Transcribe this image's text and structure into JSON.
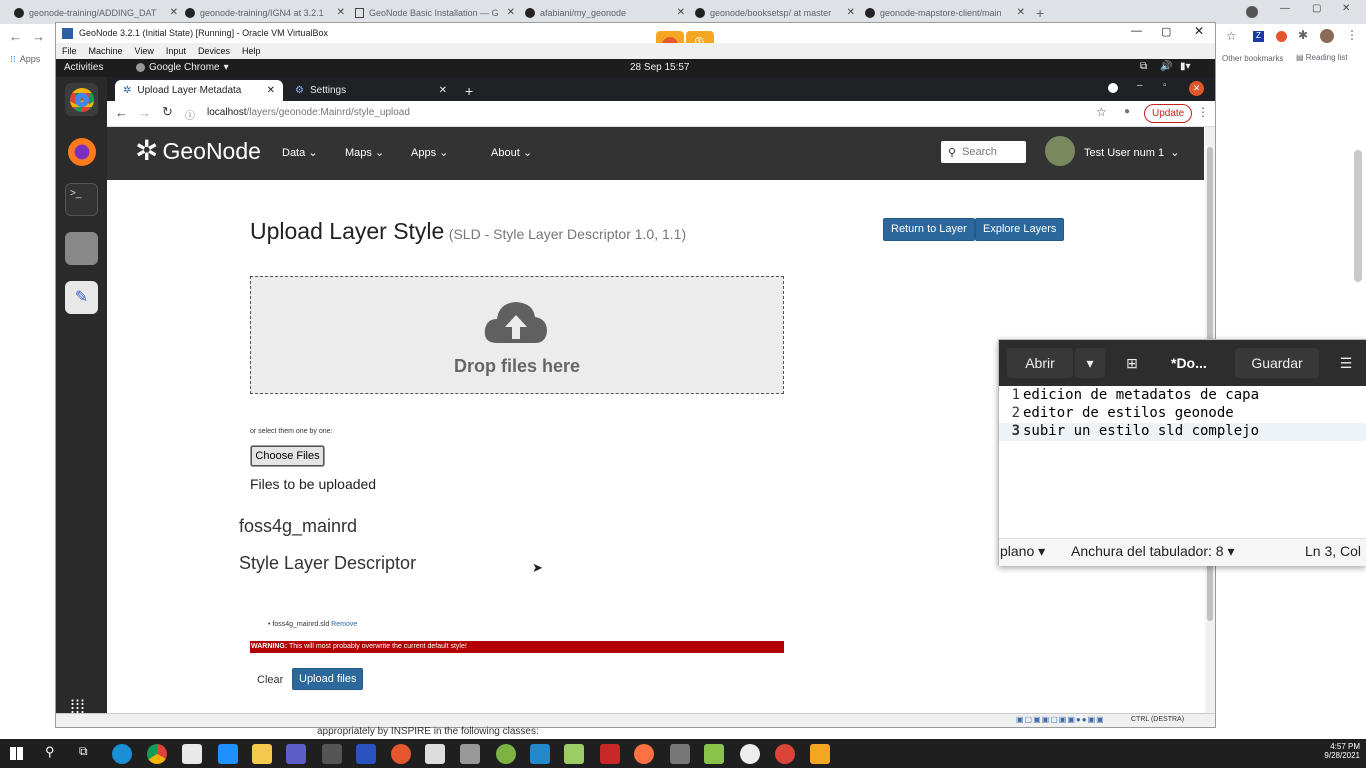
{
  "host_browser": {
    "tabs": [
      {
        "label": "geonode-training/ADDING_DAT"
      },
      {
        "label": "geonode-training/IGN4 at 3.2.1"
      },
      {
        "label": "GeoNode Basic Installation — G"
      },
      {
        "label": "afabiani/my_geonode"
      },
      {
        "label": "geonode/booksetsp/ at master"
      },
      {
        "label": "geonode-mapstore-client/main"
      }
    ],
    "bookmarks_apps": "Apps",
    "other_bookmarks": "Other bookmarks",
    "reading_list": "Reading list"
  },
  "vbox": {
    "title": "GeoNode 3.2.1 (Initial State) [Running] - Oracle VM VirtualBox",
    "menu": [
      "File",
      "Machine",
      "View",
      "Input",
      "Devices",
      "Help"
    ],
    "status_right": "CTRL (DESTRA)"
  },
  "gnome": {
    "activities": "Activities",
    "app": "Google Chrome",
    "clock": "28 Sep  15:57"
  },
  "guest_browser": {
    "tabs": [
      {
        "label": "Upload Layer Metadata"
      },
      {
        "label": "Settings"
      }
    ],
    "url_host": "localhost",
    "url_path": "/layers/geonode:Mainrd/style_upload",
    "update_label": "Update"
  },
  "geonode": {
    "brand": "GeoNode",
    "nav": [
      "Data",
      "Maps",
      "Apps",
      "About"
    ],
    "search_placeholder": "Search",
    "user": "Test User num 1"
  },
  "upload": {
    "title": "Upload Layer Style",
    "subtitle": "(SLD - Style Layer Descriptor 1.0, 1.1)",
    "return_btn": "Return to Layer",
    "explore_btn": "Explore Layers",
    "drop_text": "Drop files here",
    "select_hint": "or select them one by one:",
    "choose_files": "Choose Files",
    "files_heading": "Files to be uploaded",
    "layer_name": "foss4g_mainrd",
    "descriptor_heading": "Style Layer Descriptor",
    "file_item": "foss4g_mainrd.sld",
    "remove_label": "Remove",
    "warning_bold": "WARNING:",
    "warning_text": "This will most probably overwrite the current default style!",
    "clear_btn": "Clear",
    "upload_btn": "Upload files"
  },
  "behind_text": "appropriately by INSPIRE in the following classes:",
  "gedit": {
    "open": "Abrir",
    "title": "*Do...",
    "save": "Guardar",
    "lines": [
      {
        "num": "1",
        "text": "edicion de metadatos de capa"
      },
      {
        "num": "2",
        "text": "editor de estilos geonode"
      },
      {
        "num": "3",
        "text": "subir un estilo sld complejo"
      }
    ],
    "mode": "plano",
    "tab_width": "Anchura del tabulador: 8",
    "position": "Ln 3, Col :"
  },
  "taskbar": {
    "time": "4:57 PM",
    "date": "9/28/2021"
  },
  "colors": {
    "geonode_nav": "#333333",
    "btn_blue": "#2c689c",
    "warning_red": "#b30000",
    "update_red": "#c5221f"
  }
}
